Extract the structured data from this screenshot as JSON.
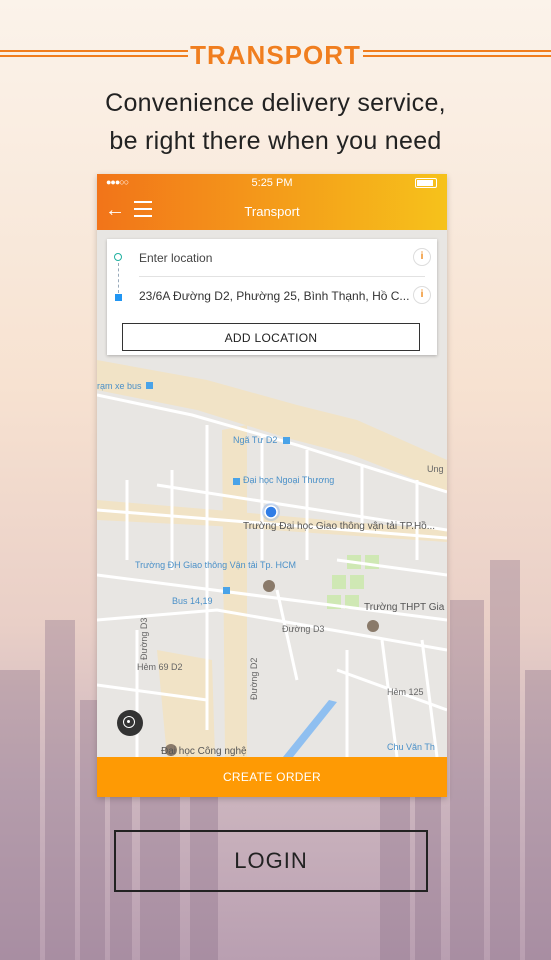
{
  "header": {
    "title": "TRANSPORT"
  },
  "tagline": {
    "line1": "Convenience delivery service,",
    "line2": "be right there when you need"
  },
  "phone": {
    "status": {
      "signal": "●●●○○",
      "time": "5:25 PM"
    },
    "appbar": {
      "title": "Transport",
      "back_icon": "arrow-left-icon",
      "menu_icon": "hamburger-menu-icon"
    },
    "form": {
      "pickup_placeholder": "Enter location",
      "dropoff_value": "23/6A Đường D2, Phường 25, Bình Thạnh, Hồ C...",
      "info_glyph": "i",
      "add_location_label": "ADD LOCATION"
    },
    "map_labels": {
      "bus_left": "rạm xe bus",
      "nga_tu": "Ngã Tư D2",
      "ngoai_thuong": "Đại học Ngoại Thương",
      "giao_thong": "Trường Đại học Giao thông vận tải TP.Hồ...",
      "dh_giao_thong": "Trường ĐH Giao thông Vận tải Tp. HCM",
      "bus_14": "Bus 14,19",
      "thpt": "Trường THPT Gia",
      "duong_d3": "Đường D3",
      "duong_d3_v": "Đường D3",
      "duong_d2_v": "Đường D2",
      "hem_69": "Hẻm 69 D2",
      "hem_125": "Hẻm 125",
      "ung": "Ung",
      "cong_nghe": "Đại học Công nghệ",
      "chu_van": "Chu Văn Th"
    },
    "create_order_label": "CREATE ORDER"
  },
  "login_label": "LOGIN",
  "colors": {
    "accent": "#f07e1f",
    "orange_button": "#fe9a04",
    "gradient_end": "#f6c21b"
  }
}
